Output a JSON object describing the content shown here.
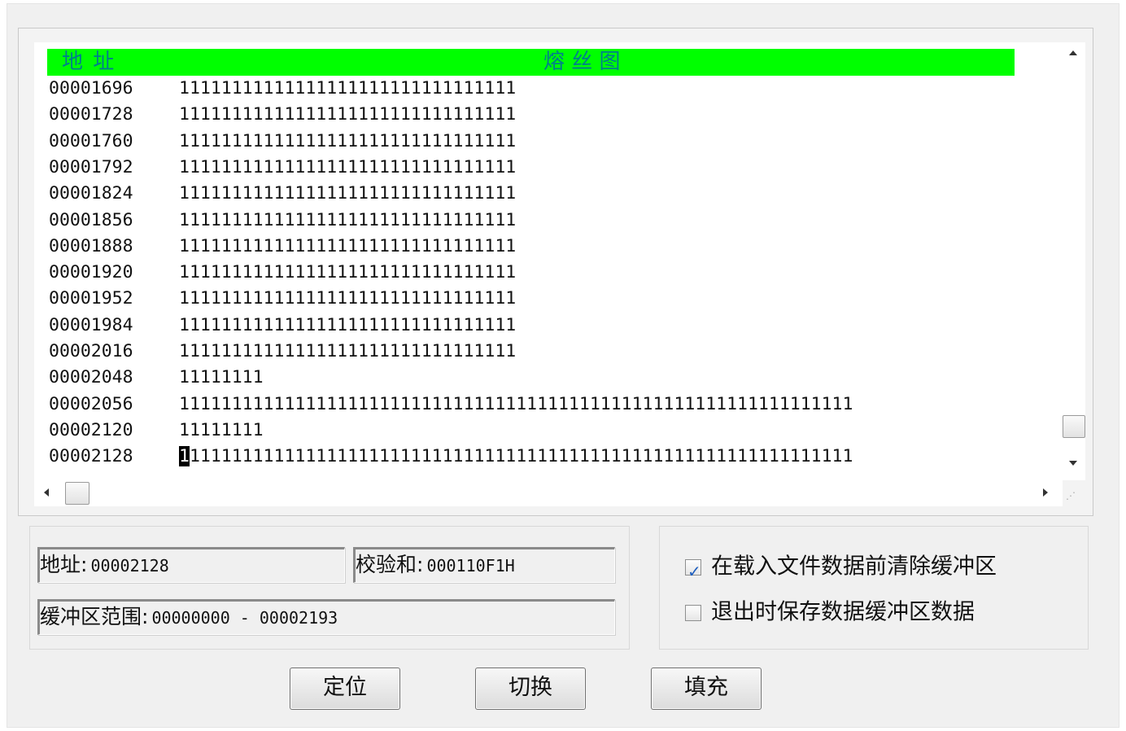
{
  "fuse_map": {
    "header": {
      "address_label": "地 址",
      "fuse_label": "熔 丝 图"
    },
    "rows": [
      {
        "address": "00001696",
        "bits": "11111111111111111111111111111111"
      },
      {
        "address": "00001728",
        "bits": "11111111111111111111111111111111"
      },
      {
        "address": "00001760",
        "bits": "11111111111111111111111111111111"
      },
      {
        "address": "00001792",
        "bits": "11111111111111111111111111111111"
      },
      {
        "address": "00001824",
        "bits": "11111111111111111111111111111111"
      },
      {
        "address": "00001856",
        "bits": "11111111111111111111111111111111"
      },
      {
        "address": "00001888",
        "bits": "11111111111111111111111111111111"
      },
      {
        "address": "00001920",
        "bits": "11111111111111111111111111111111"
      },
      {
        "address": "00001952",
        "bits": "11111111111111111111111111111111"
      },
      {
        "address": "00001984",
        "bits": "11111111111111111111111111111111"
      },
      {
        "address": "00002016",
        "bits": "11111111111111111111111111111111"
      },
      {
        "address": "00002048",
        "bits": "11111111"
      },
      {
        "address": "00002056",
        "bits": "1111111111111111111111111111111111111111111111111111111111111111"
      },
      {
        "address": "00002120",
        "bits": "11111111"
      },
      {
        "address": "00002128",
        "bits": "1111111111111111111111111111111111111111111111111111111111111111"
      }
    ],
    "cursor_row": 14
  },
  "info": {
    "address_label": "地址:",
    "address_value": "00002128",
    "checksum_label": "校验和:",
    "checksum_value": "000110F1H",
    "buffer_label": "缓冲区范围:",
    "buffer_value": "00000000 - 00002193"
  },
  "options": {
    "clear_buffer_label": "在载入文件数据前清除缓冲区",
    "clear_buffer_checked": true,
    "save_on_exit_label": "退出时保存数据缓冲区数据",
    "save_on_exit_checked": false
  },
  "buttons": {
    "locate": "定位",
    "switch": "切换",
    "fill": "填充"
  },
  "colors": {
    "header_bg": "#00ff00",
    "header_text": "#007f8c"
  }
}
